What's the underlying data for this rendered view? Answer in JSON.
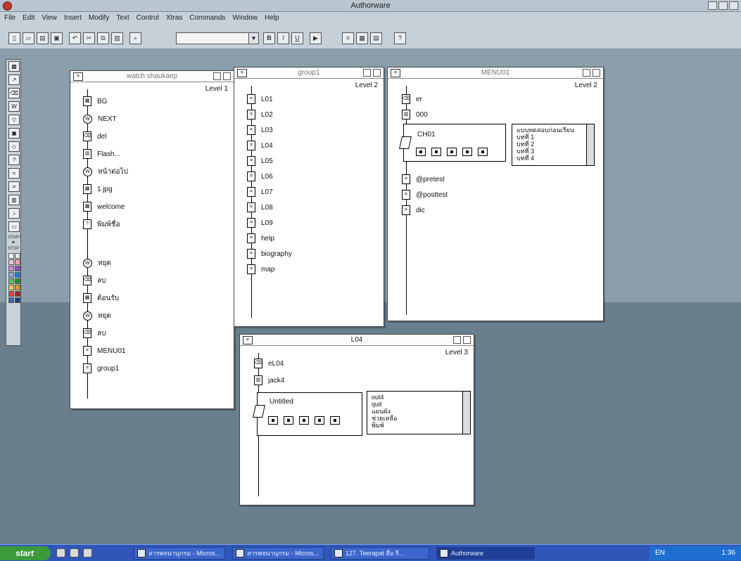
{
  "app": {
    "title": "Authorware"
  },
  "menu": [
    "File",
    "Edit",
    "View",
    "Insert",
    "Modify",
    "Text",
    "Control",
    "Xtras",
    "Commands",
    "Window",
    "Help"
  ],
  "toolbar": {
    "font_dropdown_value": "",
    "buttons": [
      {
        "name": "new-file-icon",
        "glyph": "▯"
      },
      {
        "name": "open-file-icon",
        "glyph": "▱"
      },
      {
        "name": "save-all-icon",
        "glyph": "▤"
      },
      {
        "name": "import-icon",
        "glyph": "▣"
      },
      {
        "name": "undo-icon",
        "glyph": "↶"
      },
      {
        "name": "cut-icon",
        "glyph": "✂"
      },
      {
        "name": "copy-icon",
        "glyph": "⧉"
      },
      {
        "name": "paste-icon",
        "glyph": "▥"
      },
      {
        "name": "find-icon",
        "glyph": "⌕"
      },
      {
        "name": "bold-icon",
        "glyph": "B"
      },
      {
        "name": "italic-icon",
        "glyph": "I"
      },
      {
        "name": "underline-icon",
        "glyph": "U"
      },
      {
        "name": "run-icon",
        "glyph": "▶"
      },
      {
        "name": "control-panel-icon",
        "glyph": "⌗"
      },
      {
        "name": "functions-icon",
        "glyph": "▦"
      },
      {
        "name": "variables-icon",
        "glyph": "▤"
      },
      {
        "name": "knowledge-objects-icon",
        "glyph": "?"
      }
    ]
  },
  "palette": {
    "tools": [
      "display-icon",
      "motion-icon",
      "erase-icon",
      "wait-icon",
      "navigate-icon",
      "framework-icon",
      "decision-icon",
      "interaction-icon",
      "calculation-icon",
      "map-icon",
      "digital-movie-icon",
      "sound-icon",
      "video-icon"
    ],
    "flags": [
      "START",
      "STOP"
    ],
    "swatches": [
      "#ffffff",
      "#e9e9e9",
      "#f1c6d6",
      "#f3a3b8",
      "#c48ad0",
      "#8d4fb8",
      "#7fb0e0",
      "#2b7bd4",
      "#63c25c",
      "#1e8f3a",
      "#f2d24a",
      "#e39a2a",
      "#e0483a",
      "#a62020",
      "#3d6ab0",
      "#1c3f86"
    ]
  },
  "windows": {
    "level1": {
      "title": "watch shaukaep",
      "level": "Level 1",
      "nodes": [
        {
          "icon": "display-icon",
          "glyph": "▩",
          "label": "BG"
        },
        {
          "icon": "wait-icon",
          "glyph": "W",
          "label": "NEXT"
        },
        {
          "icon": "erase-icon",
          "glyph": "⌫",
          "label": "del"
        },
        {
          "icon": "movie-icon",
          "glyph": "▥",
          "label": "Flash..."
        },
        {
          "icon": "wait-icon",
          "glyph": "W",
          "label": "หน้าต่อไป"
        },
        {
          "icon": "display-icon",
          "glyph": "▩",
          "label": "1.jpg"
        },
        {
          "icon": "display-icon",
          "glyph": "▩",
          "label": "welcome"
        },
        {
          "icon": "interaction-icon",
          "glyph": "?",
          "label": "พิมพ์ชื่อ"
        },
        {
          "icon": "wait-icon",
          "glyph": "W",
          "label": "หยุด"
        },
        {
          "icon": "erase-icon",
          "glyph": "⌫",
          "label": "ลบ"
        },
        {
          "icon": "display-icon",
          "glyph": "▩",
          "label": "ต้อนรับ"
        },
        {
          "icon": "wait-icon",
          "glyph": "W",
          "label": "หยุด"
        },
        {
          "icon": "erase-icon",
          "glyph": "⌫",
          "label": "ลบ"
        },
        {
          "icon": "map-icon",
          "glyph": "⌗",
          "label": "MENU01"
        },
        {
          "icon": "map-icon",
          "glyph": "⌗",
          "label": "group1"
        }
      ]
    },
    "level2a": {
      "title": "group1",
      "level": "Level 2",
      "nodes": [
        "L01",
        "L02",
        "L03",
        "L04",
        "L05",
        "L06",
        "L07",
        "L08",
        "L09",
        "help",
        "biography",
        "map"
      ]
    },
    "level2b": {
      "title": "MENU01",
      "level": "Level 2",
      "nodes_top": [
        {
          "icon": "erase-icon",
          "glyph": "⌫",
          "label": "er"
        },
        {
          "icon": "movie-icon",
          "glyph": "▥",
          "label": "000"
        }
      ],
      "interaction_label": "CH01",
      "list": [
        "แบบทดสอบก่อนเรียน",
        "บทที่ 1",
        "บทที่ 2",
        "บทที่ 3",
        "บทที่ 4"
      ],
      "nodes_bottom": [
        "@pretest",
        "@posttest",
        "dic"
      ]
    },
    "level3": {
      "title": "L04",
      "level": "Level 3",
      "nodes_top": [
        {
          "icon": "erase-icon",
          "glyph": "⌫",
          "label": "eL04"
        },
        {
          "icon": "movie-icon",
          "glyph": "▥",
          "label": "jack4"
        }
      ],
      "interaction_label": "Untitled",
      "list": [
        "out4",
        "quit",
        "แผนผัง",
        "ช่วยเหลือ",
        "พิมพ์"
      ]
    }
  },
  "taskbar": {
    "start": "start",
    "tasks": [
      {
        "label": "สารพจนานุกรม - Micros...",
        "active": false
      },
      {
        "label": "สารพจนานุกรม - Micros...",
        "active": false
      },
      {
        "label": "127. Teerapat สื่อ รี...",
        "active": false
      },
      {
        "label": "Authorware",
        "active": true
      }
    ],
    "lang": "EN",
    "clock": "1:36"
  }
}
